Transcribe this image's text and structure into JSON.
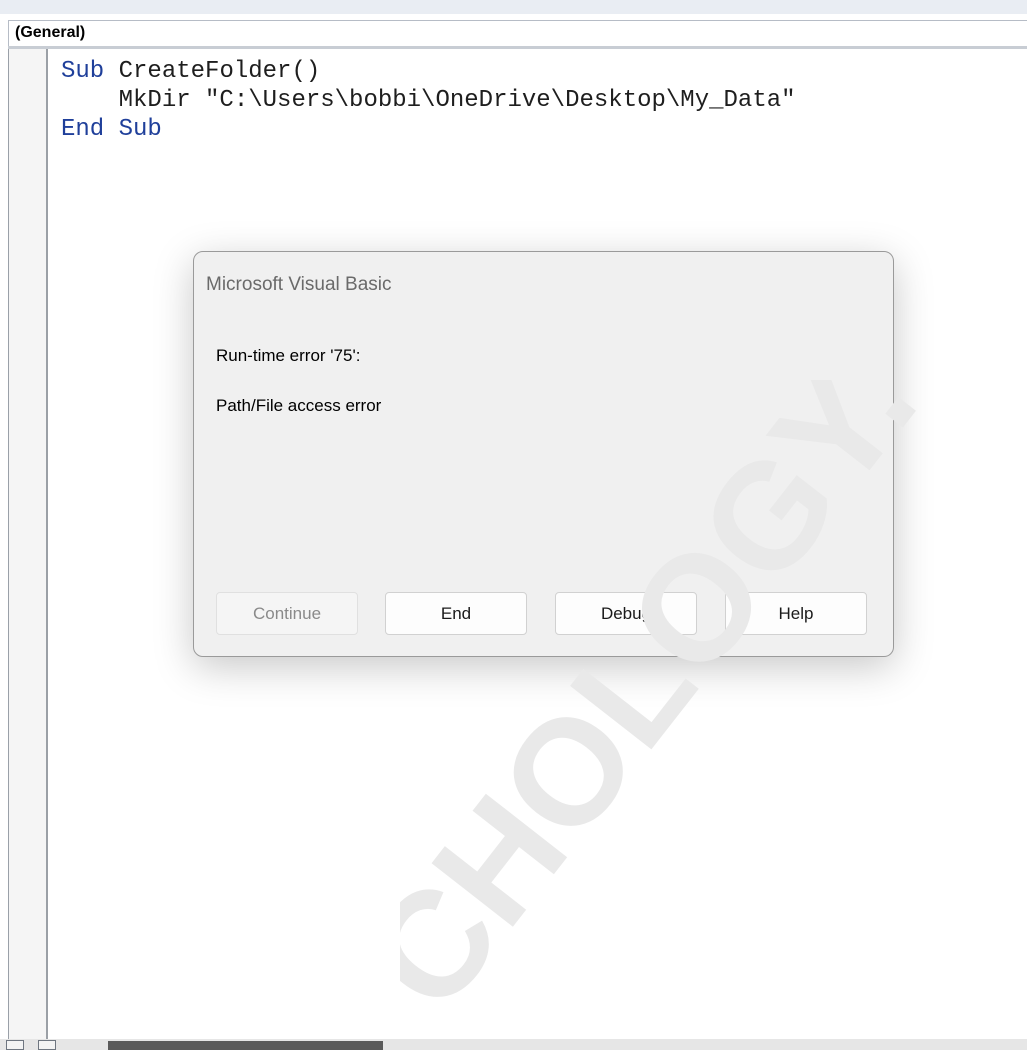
{
  "editor": {
    "object_combo": "(General)",
    "code_lines": [
      {
        "kw1": "Sub",
        "rest": " CreateFolder()"
      },
      {
        "kw1": "",
        "rest": "    MkDir \"C:\\Users\\bobbi\\OneDrive\\Desktop\\My_Data\""
      },
      {
        "kw1": "End",
        "kw2": "Sub",
        "rest": ""
      }
    ]
  },
  "dialog": {
    "title": "Microsoft Visual Basic",
    "error_code": "Run-time error '75':",
    "error_message": "Path/File access error",
    "buttons": {
      "continue": "Continue",
      "end": "End",
      "debug": "Debug",
      "help": "Help"
    }
  },
  "watermark": {
    "text": "CHOLOGY.C"
  },
  "colors": {
    "keyword": "#1f3f9a",
    "dialog_bg": "#f0f0f0",
    "watermark": "#e9e9e9"
  }
}
